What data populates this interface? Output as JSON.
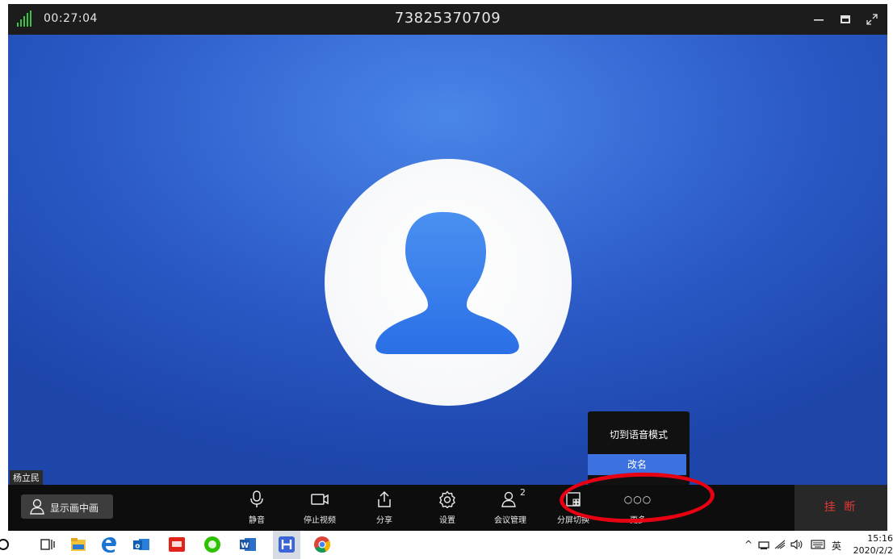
{
  "titlebar": {
    "call_timer": "00:27:04",
    "meeting_id": "73825370709"
  },
  "video": {
    "participant_name": "杨立民"
  },
  "popup_menu": {
    "items": [
      "切到语音模式",
      "改名"
    ]
  },
  "toolbar": {
    "show_name_label": "显示画中画",
    "tools": [
      {
        "icon": "microphone-icon",
        "label": "静音"
      },
      {
        "icon": "video-camera-icon",
        "label": "停止视频"
      },
      {
        "icon": "share-icon",
        "label": "分享"
      },
      {
        "icon": "gear-icon",
        "label": "设置"
      },
      {
        "icon": "participants-icon",
        "label": "会议管理",
        "badge": "2"
      },
      {
        "icon": "layout-icon",
        "label": "分屏切换"
      },
      {
        "icon": "more-icon",
        "label": "更多",
        "glyph": "○○○"
      }
    ],
    "hangup_label": "挂 断"
  },
  "taskbar": {
    "apps": [
      "cortana-icon",
      "task-view-icon",
      "file-explorer-icon",
      "edge-icon",
      "outlook-icon",
      "youdao-icon",
      "wechat-icon",
      "word-icon",
      "meeting-app-icon",
      "chrome-icon"
    ],
    "tray_input_language": "英",
    "clock_time": "15:16",
    "clock_date": "2020/2/2"
  },
  "colors": {
    "accent_blue": "#3c71e0",
    "hangup_red": "#e03a35",
    "annotation_red": "#e60012"
  }
}
